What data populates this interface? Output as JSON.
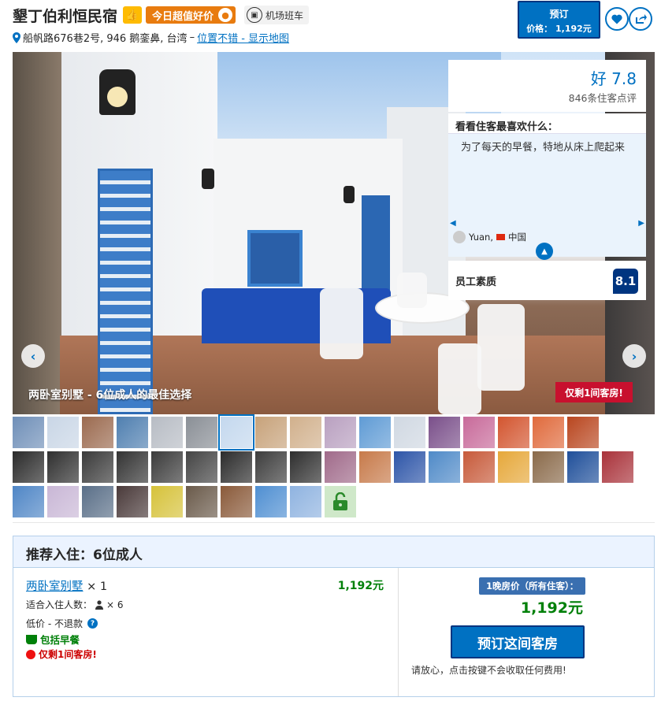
{
  "header": {
    "hotel_name": "墾丁伯利恒民宿",
    "deal_label": "今日超值好价",
    "shuttle_label": "机场班车",
    "address": "船帆路676巷2号, 946 鹅銮鼻, 台湾",
    "address_sep": "–",
    "location_link": "位置不错 - 显示地图"
  },
  "book_button": {
    "label": "预订",
    "price_line": "价格： 1,192元"
  },
  "photo": {
    "caption": "两卧室别墅 - 6位成人的最佳选择",
    "scarcity_tag": "仅剩1间客房!",
    "prev_arrow": "‹",
    "next_arrow": "›"
  },
  "review": {
    "score_text": "好 7.8",
    "review_count": "846条住客点评",
    "guests_like_heading": "看看住客最喜欢什么：",
    "quote": "为了每天的早餐，特地从床上爬起来",
    "author": "Yuan,",
    "country": "中国",
    "staff_label": "员工素质",
    "staff_score": "8.1"
  },
  "room_panel": {
    "heading": "推荐入住：6位成人",
    "room_name": "两卧室别墅",
    "room_qty": "× 1",
    "room_price": "1,192元",
    "occupancy_label": "适合入住人数：",
    "occupancy_value": "× 6",
    "refund": "低价 - 不退款",
    "breakfast": "包括早餐",
    "scarcity": "仅剩1间客房!",
    "night_label": "1晚房价（所有住客）：",
    "total_price": "1,192元",
    "reserve_button": "预订这间客房",
    "reassure": "请放心，点击按键不会收取任何费用!"
  },
  "colors": {
    "brand_blue": "#0071c2",
    "dark_blue": "#003580",
    "price_green": "#008009",
    "deal_orange": "#e87b0f",
    "alert_red": "#c8102e"
  }
}
